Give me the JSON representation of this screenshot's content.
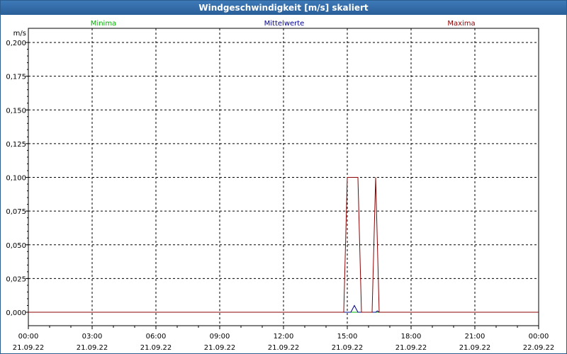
{
  "window": {
    "title": "Windgeschwindigkeit [m/s] skaliert"
  },
  "colors": {
    "minima": "#00b000",
    "mittel": "#00008b",
    "maxima": "#8b0000",
    "titlebar": "#2f6aa8"
  },
  "chart_data": {
    "type": "line",
    "ylabel": "m/s",
    "ylim": [
      0,
      0.2
    ],
    "yticks": [
      "0,000",
      "0,025",
      "0,050",
      "0,075",
      "0,100",
      "0,125",
      "0,150",
      "0,175",
      "0,200"
    ],
    "xlim": [
      "2022-09-21T00:00",
      "2022-09-22T00:00"
    ],
    "xticks": [
      {
        "time": "00:00",
        "date": "21.09.22"
      },
      {
        "time": "03:00",
        "date": "21.09.22"
      },
      {
        "time": "06:00",
        "date": "21.09.22"
      },
      {
        "time": "09:00",
        "date": "21.09.22"
      },
      {
        "time": "12:00",
        "date": "21.09.22"
      },
      {
        "time": "15:00",
        "date": "21.09.22"
      },
      {
        "time": "18:00",
        "date": "21.09.22"
      },
      {
        "time": "21:00",
        "date": "21.09.22"
      },
      {
        "time": "00:00",
        "date": "22.09.22"
      }
    ],
    "grid": true,
    "legend_position": "top",
    "series": [
      {
        "name": "Minima",
        "color": "#00b000",
        "points": [
          [
            "2022-09-21T00:00",
            0
          ],
          [
            "2022-09-22T00:00",
            0
          ]
        ]
      },
      {
        "name": "Mittelwerte",
        "color": "#00008b",
        "points": [
          [
            "2022-09-21T00:00",
            0
          ],
          [
            "2022-09-21T15:10",
            0
          ],
          [
            "2022-09-21T15:20",
            0.005
          ],
          [
            "2022-09-21T15:30",
            0
          ],
          [
            "2022-09-21T16:20",
            0
          ],
          [
            "2022-09-21T16:25",
            0.001
          ],
          [
            "2022-09-21T16:30",
            0
          ],
          [
            "2022-09-22T00:00",
            0
          ]
        ]
      },
      {
        "name": "Maxima",
        "color": "#8b0000",
        "points": [
          [
            "2022-09-21T00:00",
            0
          ],
          [
            "2022-09-21T14:50",
            0
          ],
          [
            "2022-09-21T15:00",
            0.1
          ],
          [
            "2022-09-21T15:30",
            0.1
          ],
          [
            "2022-09-21T15:40",
            0
          ],
          [
            "2022-09-21T16:10",
            0
          ],
          [
            "2022-09-21T16:20",
            0.1
          ],
          [
            "2022-09-21T16:30",
            0
          ],
          [
            "2022-09-22T00:00",
            0
          ]
        ]
      }
    ]
  }
}
